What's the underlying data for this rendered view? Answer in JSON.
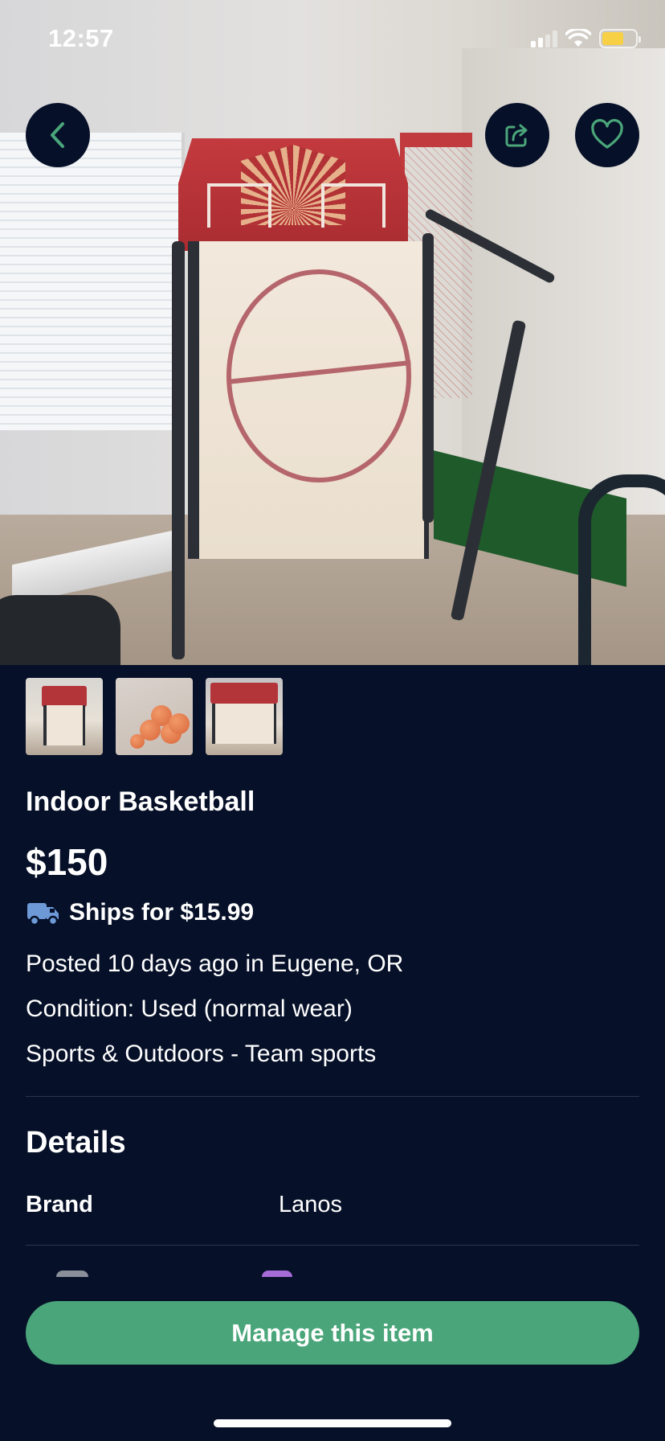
{
  "status_bar": {
    "time": "12:57",
    "signal_icon": "cellular-signal-icon",
    "wifi_icon": "wifi-icon",
    "battery_icon": "battery-icon",
    "battery_color": "#f7d046"
  },
  "header_actions": {
    "back_icon": "chevron-left-icon",
    "share_icon": "share-icon",
    "favorite_icon": "heart-icon",
    "icon_color": "#4aa67a"
  },
  "gallery": {
    "thumbnail_count": 3
  },
  "product": {
    "title": "Indoor Basketball",
    "price": "$150",
    "shipping_icon": "truck-icon",
    "shipping": "Ships for $15.99",
    "posted": "Posted 10 days ago in Eugene, OR",
    "condition": "Condition: Used (normal wear)",
    "category": "Sports & Outdoors - Team sports"
  },
  "details": {
    "heading": "Details",
    "rows": [
      {
        "label": "Brand",
        "value": "Lanos"
      }
    ]
  },
  "actions": {
    "manage_label": "Manage this item",
    "accent_color": "#4aa67a"
  },
  "theme": {
    "background": "#061028",
    "text": "#ffffff"
  }
}
